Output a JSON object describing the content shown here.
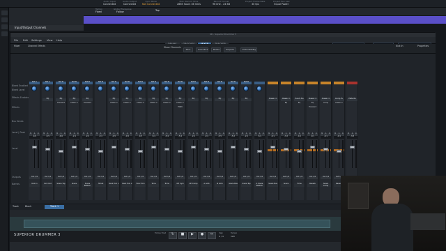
{
  "host": {
    "status": [
      {
        "label": "Audio Input",
        "value": "Connected"
      },
      {
        "label": "Audio Output",
        "value": "Connected"
      },
      {
        "label": "Sync Mode",
        "value": "Not Connected",
        "accent": true
      },
      {
        "label": "Max. Record Time",
        "value": "2865 hours 36 mins"
      },
      {
        "label": "Record Format",
        "value": "96 kHz - 24 Bit"
      },
      {
        "label": "Project Frame Rate",
        "value": "30 fps"
      },
      {
        "label": "Project Pan Law",
        "value": "Equal Power"
      }
    ],
    "transport": {
      "tempo_label": "Tempo",
      "tempo": "Fixed",
      "signature_label": "Global Transpose",
      "signature": "Follow",
      "tap": "Tap"
    },
    "track_header": "Input/Output Channels",
    "tempo_track": "Tempo"
  },
  "plugin": {
    "title": "SD - Superior Drummer 3",
    "menu": [
      "File",
      "Edit",
      "Settings",
      "View",
      "Help"
    ],
    "tabs": [
      {
        "label": "DRUMS"
      },
      {
        "label": "GROOVES"
      },
      {
        "label": "MIXER",
        "active": true
      },
      {
        "label": "TRACKER"
      }
    ],
    "preset_left": "Superior Drummer 3",
    "preset_right": "Kick In",
    "position": "1:01:000",
    "mixer_label": "Mixer",
    "channel_effects": "Channel Effects",
    "show_channels": "Show Channels",
    "mics_label": "Mics",
    "mics_value": "1/2",
    "user_mics_label": "User Mics",
    "user_mics_value": "1/2",
    "buses_label": "Buses",
    "buses_value": "1/2",
    "outputs_label": "Outputs",
    "outputs_value": "1/2",
    "edit_visibility": "Edit Visibility",
    "selected_channel_label": "Kick In",
    "properties": "Properties",
    "row_labels": {
      "bleed_enabled": "Bleed Enabled",
      "bleed_level": "Bleed Level",
      "effects_enabled": "Effects Enabled",
      "effects": "Effects",
      "bus_sends": "Bus Sends",
      "level_peak": "Level | Peak",
      "level": "Level",
      "outputs": "Outputs",
      "names": "Names"
    }
  },
  "channels": [
    {
      "hdr": "B/T A",
      "fx": [],
      "vol": "-4.9",
      "out": "Out 1/2",
      "name": "Kick In",
      "type": "mic"
    },
    {
      "hdr": "B/T A",
      "fx": [
        "EQ"
      ],
      "vol": "-5.5",
      "out": "Out 1/2",
      "name": "Kick Out",
      "type": "mic"
    },
    {
      "hdr": "B/T B",
      "fx": [
        "EQ",
        "Transient"
      ],
      "vol": "-6.6",
      "out": "Out 1/2",
      "name": "Snare Top",
      "type": "mic"
    },
    {
      "hdr": "B/T B",
      "fx": [
        "EQ",
        "Classic C"
      ],
      "vol": "-2.1",
      "out": "Out 1/2",
      "name": "Snare",
      "type": "mic"
    },
    {
      "hdr": "B/T B",
      "fx": [
        "EQ",
        "Transient"
      ],
      "vol": "-2.2",
      "out": "Out 1/2",
      "name": "Snare Bottom",
      "type": "mic"
    },
    {
      "hdr": "B/T B",
      "fx": [],
      "vol": "-2.2",
      "out": "Out 1/2",
      "name": "Hi-hat",
      "type": "mic"
    },
    {
      "hdr": "B/T B",
      "fx": [
        "EQ",
        "Classic C"
      ],
      "vol": "-4.5",
      "out": "Out 1/2",
      "name": "Rack Tom 1",
      "type": "mic"
    },
    {
      "hdr": "B/T B",
      "fx": [
        "EQ",
        "Classic C"
      ],
      "vol": "-4.5",
      "out": "Out 1/2",
      "name": "Rack Tom 2",
      "type": "mic"
    },
    {
      "hdr": "B/T B",
      "fx": [
        "EQ",
        "Classic C"
      ],
      "vol": "-4.5",
      "out": "Out 1/2",
      "name": "Floor Tom",
      "type": "mic"
    },
    {
      "hdr": "B/T B",
      "fx": [
        "EQ",
        "Classic C"
      ],
      "vol": "-5.4",
      "out": "Out 1/2",
      "name": "Toms",
      "type": "mic"
    },
    {
      "hdr": "B/T B",
      "fx": [
        "EQ",
        "Classic C"
      ],
      "vol": "-5.4",
      "out": "Out 1/2",
      "name": "Toms",
      "type": "mic"
    },
    {
      "hdr": "B/T B",
      "fx": [
        "EQ",
        "Classic C",
        "EQ96"
      ],
      "vol": "-5.4",
      "out": "Out 1/2",
      "name": "OH Cym",
      "type": "mic"
    },
    {
      "hdr": "B/T B",
      "fx": [
        "EQ"
      ],
      "vol": "-2.1",
      "out": "Out 1/2",
      "name": "OH Comp",
      "type": "mic"
    },
    {
      "hdr": "B/T B",
      "fx": [
        "EQ"
      ],
      "vol": "-2.2",
      "out": "Out 1/2",
      "name": "A Amb",
      "type": "mic"
    },
    {
      "hdr": "B/T B",
      "fx": [
        "EQ"
      ],
      "vol": "-3.5",
      "out": "Out 1/2",
      "name": "N Amb",
      "type": "mic"
    },
    {
      "hdr": "B/T B",
      "fx": [
        "EQ"
      ],
      "vol": "-5.2",
      "out": "Out 1/2",
      "name": "Snare Bus",
      "type": "mic"
    },
    {
      "hdr": "B/T B",
      "fx": [
        "EQ"
      ],
      "vol": "-2.1",
      "out": "Out 1/2",
      "name": "Snare Top",
      "type": "mic"
    },
    {
      "hdr": "",
      "fx": [],
      "vol": "-5.4",
      "out": "Out 1/2",
      "name": "K Snare Bottom",
      "type": "mic"
    },
    {
      "hdr": "",
      "fx": [
        "Classic C"
      ],
      "vol": "-0.1",
      "out": "Out 1/2",
      "name": "Snare Bus",
      "type": "bus"
    },
    {
      "hdr": "",
      "fx": [
        "Classic C",
        "EQ"
      ],
      "vol": "-3.2",
      "out": "Out 1/2",
      "name": "Snare",
      "type": "bus"
    },
    {
      "hdr": "",
      "fx": [
        "Punch Bu",
        "EQ"
      ],
      "vol": "-4.1",
      "out": "Out 1/2",
      "name": "Toms",
      "type": "bus"
    },
    {
      "hdr": "",
      "fx": [
        "Classic C",
        "EQ",
        "Transient"
      ],
      "vol": "-0.1",
      "out": "Out 1/2",
      "name": "Reverb",
      "type": "bus"
    },
    {
      "hdr": "",
      "fx": [
        "Classic C",
        "Comp"
      ],
      "vol": "-0.1",
      "out": "Out 1/2",
      "name": "Snare Comp",
      "type": "bus"
    },
    {
      "hdr": "",
      "fx": [
        "Comp Tu",
        "Classic C"
      ],
      "vol": "-0.1",
      "out": "Out 1/2",
      "name": "Reverb",
      "type": "bus"
    },
    {
      "hdr": "",
      "fx": [
        "Plate Ro"
      ],
      "vol": "-3.8",
      "out": "Out 1/2",
      "name": "Snare",
      "type": "last"
    }
  ],
  "bottom": {
    "track_label": "Track",
    "track_value": "Block",
    "track_name": "Track 1",
    "brand": "SUPERIOR DRUMMER 3",
    "sign": "Sign",
    "sign_value": "4 / 4",
    "tempo_label": "Tempo",
    "tempo_value": "120",
    "follow_label": "Follow Host"
  },
  "colors": {
    "accent": "#3b6ea3",
    "bus": "#c7842a",
    "timeline": "#5a4fc8"
  }
}
